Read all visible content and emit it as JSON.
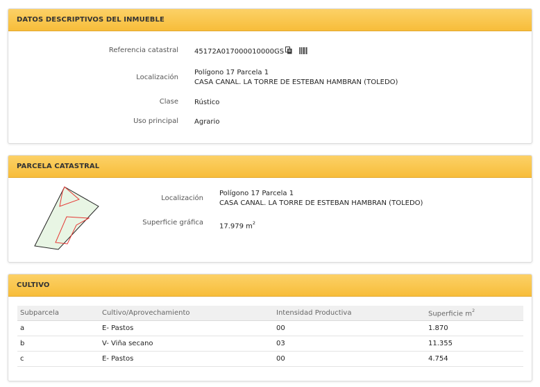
{
  "descriptivos": {
    "title": "DATOS DESCRIPTIVOS DEL INMUEBLE",
    "ref_label": "Referencia catastral",
    "ref_value": "45172A017000010000GS",
    "loc_label": "Localización",
    "loc_line1": "Polígono 17 Parcela 1",
    "loc_line2": "CASA CANAL. LA TORRE DE ESTEBAN HAMBRAN (TOLEDO)",
    "clase_label": "Clase",
    "clase_value": "Rústico",
    "uso_label": "Uso principal",
    "uso_value": "Agrario",
    "copy_icon": "copy-icon",
    "barcode_icon": "barcode-icon"
  },
  "parcela": {
    "title": "PARCELA CATASTRAL",
    "loc_label": "Localización",
    "loc_line1": "Polígono 17 Parcela 1",
    "loc_line2": "CASA CANAL. LA TORRE DE ESTEBAN HAMBRAN (TOLEDO)",
    "sup_label": "Superficie gráfica",
    "sup_value": "17.979 m",
    "sup_exp": "2"
  },
  "cultivo": {
    "title": "CULTIVO",
    "headers": [
      "Subparcela",
      "Cultivo/Aprovechamiento",
      "Intensidad Productiva",
      "Superficie m"
    ],
    "header_exp": "2",
    "rows": [
      [
        "a",
        "E- Pastos",
        "00",
        "1.870"
      ],
      [
        "b",
        "V- Viña secano",
        "03",
        "11.355"
      ],
      [
        "c",
        "E- Pastos",
        "00",
        "4.754"
      ]
    ]
  },
  "colors": {
    "header_gradient_top": "#fcd167",
    "header_gradient_bottom": "#f7bd3a",
    "parcel_fill": "#e8f5e4",
    "subparcel_stroke": "#e53935"
  }
}
